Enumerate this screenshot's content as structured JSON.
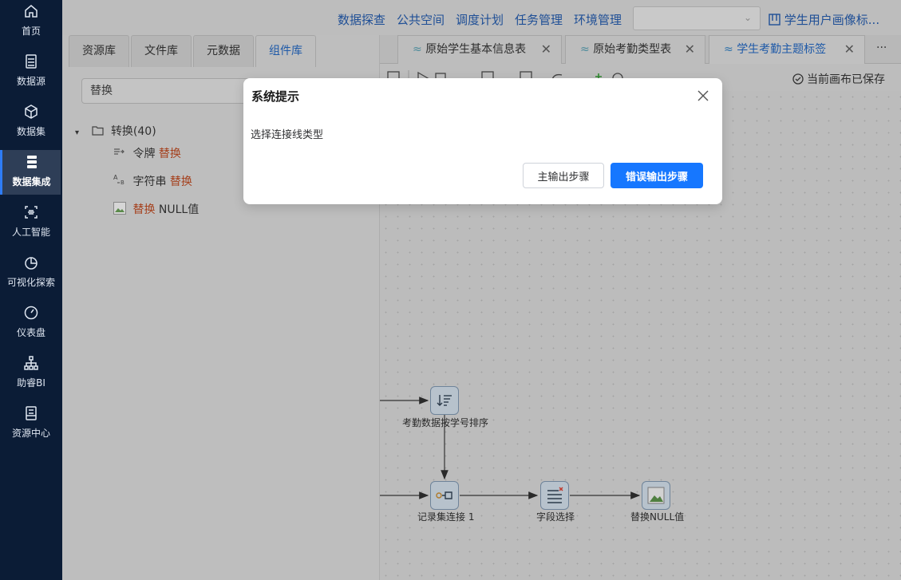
{
  "sidebar": {
    "items": [
      {
        "label": "首页",
        "icon": "home-icon"
      },
      {
        "label": "数据源",
        "icon": "database-icon"
      },
      {
        "label": "数据集",
        "icon": "cube-icon"
      },
      {
        "label": "数据集成",
        "icon": "server-icon",
        "active": true
      },
      {
        "label": "人工智能",
        "icon": "ai-scan-icon"
      },
      {
        "label": "可视化探索",
        "icon": "pie-chart-icon"
      },
      {
        "label": "仪表盘",
        "icon": "gauge-icon"
      },
      {
        "label": "助睿BI",
        "icon": "org-chart-icon"
      },
      {
        "label": "资源中心",
        "icon": "resource-icon"
      }
    ]
  },
  "header": {
    "nav": [
      "数据探查",
      "公共空间",
      "调度计划",
      "任务管理",
      "环境管理"
    ],
    "select_value": "",
    "project_title": "学生用户画像标..."
  },
  "left_panel": {
    "tabs": [
      "资源库",
      "文件库",
      "元数据",
      "组件库"
    ],
    "active_tab": "组件库",
    "search_value": "替换",
    "tree": {
      "folder_label": "转换(40)",
      "items": [
        {
          "prefix": "令牌 ",
          "highlight": "替换",
          "suffix": ""
        },
        {
          "prefix": "字符串 ",
          "highlight": "替换",
          "suffix": ""
        },
        {
          "prefix": "",
          "highlight": "替换",
          "suffix": " NULL值"
        }
      ]
    }
  },
  "canvas_tabs": {
    "tabs": [
      "原始学生基本信息表",
      "原始考勤类型表",
      "学生考勤主题标签"
    ],
    "more": "···",
    "active_index": 2
  },
  "toolbar": {
    "saved_status": "当前画布已保存"
  },
  "canvas": {
    "nodes": [
      {
        "label": "考勤数据按学号排序",
        "icon": "sort-icon"
      },
      {
        "label": "记录集连接 1",
        "icon": "merge-join-icon"
      },
      {
        "label": "字段选择",
        "icon": "field-select-icon"
      },
      {
        "label": "替换NULL值",
        "icon": "broken-image-icon"
      }
    ]
  },
  "dialog": {
    "title": "系统提示",
    "message": "选择连接线类型",
    "secondary_button": "主输出步骤",
    "primary_button": "错误输出步骤",
    "primary_color": "#1677ff"
  },
  "colors": {
    "sidebar_bg": "#0b1c36",
    "accent": "#1677ff",
    "highlight_text": "#a5411e"
  }
}
